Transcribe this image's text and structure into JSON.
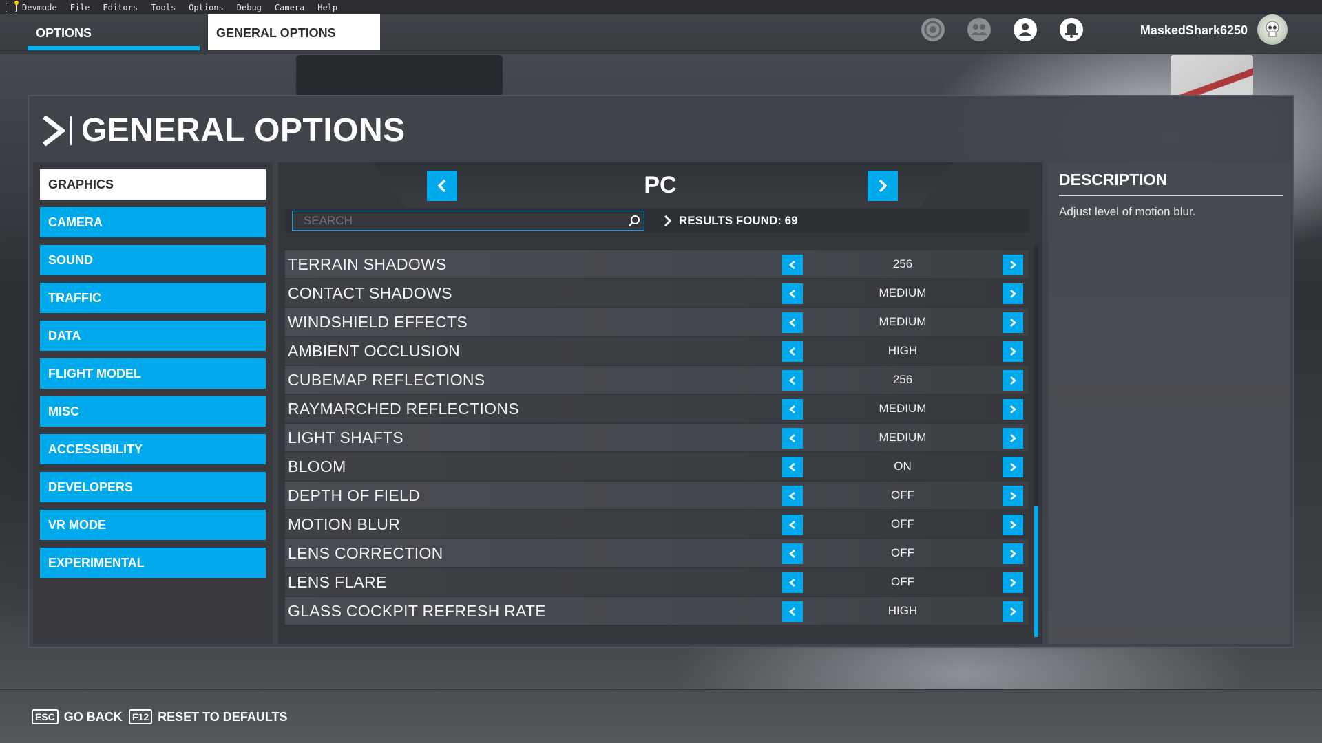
{
  "menubar": {
    "items": [
      "Devmode",
      "File",
      "Editors",
      "Tools",
      "Options",
      "Debug",
      "Camera",
      "Help"
    ]
  },
  "header": {
    "tab_options": "OPTIONS",
    "tab_general": "GENERAL OPTIONS",
    "username": "MaskedShark6250",
    "icons": [
      "achievements-icon",
      "friends-icon",
      "profile-icon",
      "notification-icon"
    ]
  },
  "page": {
    "title": "GENERAL OPTIONS"
  },
  "sidebar": {
    "items": [
      {
        "label": "GRAPHICS",
        "active": true
      },
      {
        "label": "CAMERA",
        "active": false
      },
      {
        "label": "SOUND",
        "active": false
      },
      {
        "label": "TRAFFIC",
        "active": false
      },
      {
        "label": "DATA",
        "active": false
      },
      {
        "label": "FLIGHT MODEL",
        "active": false
      },
      {
        "label": "MISC",
        "active": false
      },
      {
        "label": "ACCESSIBILITY",
        "active": false
      },
      {
        "label": "DEVELOPERS",
        "active": false
      },
      {
        "label": "VR MODE",
        "active": false
      },
      {
        "label": "EXPERIMENTAL",
        "active": false
      }
    ]
  },
  "platform": {
    "label": "PC"
  },
  "search": {
    "placeholder": "SEARCH",
    "value": ""
  },
  "results": {
    "text": "RESULTS FOUND: 69"
  },
  "settings": [
    {
      "label": "TERRAIN SHADOWS",
      "value": "256"
    },
    {
      "label": "CONTACT SHADOWS",
      "value": "MEDIUM"
    },
    {
      "label": "WINDSHIELD EFFECTS",
      "value": "MEDIUM"
    },
    {
      "label": "AMBIENT OCCLUSION",
      "value": "HIGH"
    },
    {
      "label": "CUBEMAP REFLECTIONS",
      "value": "256"
    },
    {
      "label": "RAYMARCHED REFLECTIONS",
      "value": "MEDIUM"
    },
    {
      "label": "LIGHT SHAFTS",
      "value": "MEDIUM"
    },
    {
      "label": "BLOOM",
      "value": "ON"
    },
    {
      "label": "DEPTH OF FIELD",
      "value": "OFF"
    },
    {
      "label": "MOTION BLUR",
      "value": "OFF"
    },
    {
      "label": "LENS CORRECTION",
      "value": "OFF"
    },
    {
      "label": "LENS FLARE",
      "value": "OFF"
    },
    {
      "label": "GLASS COCKPIT REFRESH RATE",
      "value": "HIGH"
    }
  ],
  "description": {
    "title": "DESCRIPTION",
    "text": "Adjust level of motion blur."
  },
  "footer": {
    "back_key": "ESC",
    "back_label": "GO BACK",
    "reset_key": "F12",
    "reset_label": "RESET TO DEFAULTS"
  },
  "colors": {
    "accent": "#00a9ec",
    "panel": "#404349"
  }
}
